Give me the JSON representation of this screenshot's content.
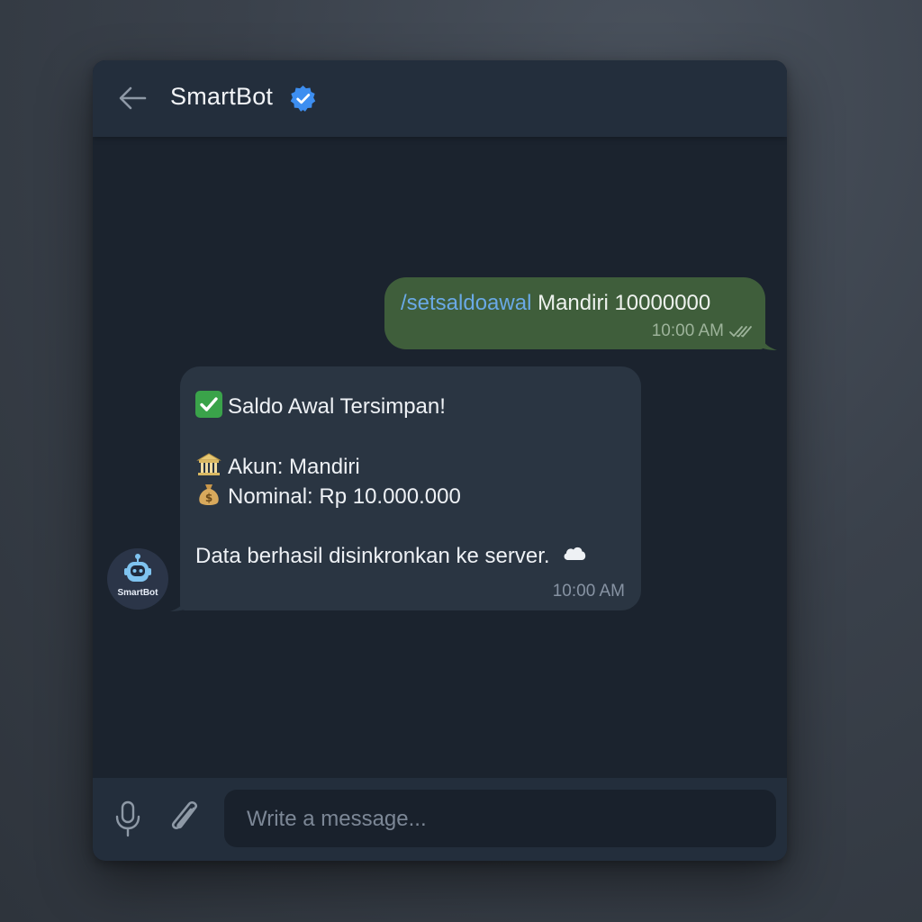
{
  "header": {
    "title": "SmartBot",
    "back_icon": "arrow-left-icon",
    "verified_icon": "verified-badge-icon"
  },
  "messages": {
    "outgoing": {
      "command": "/setsaldoawal",
      "text": " Mandiri 10000000",
      "time": "10:00 AM",
      "status_icon": "double-check-icon"
    },
    "incoming": {
      "title": "Saldo Awal Tersimpan!",
      "account_line": "Akun: Mandiri",
      "nominal_line": "Nominal: Rp 10.000.000",
      "sync_line": "Data berhasil disinkronkan ke server.",
      "time": "10:00 AM",
      "emoji_icons": [
        "check-mark-button-icon",
        "bank-icon",
        "money-bag-icon",
        "cloud-icon"
      ]
    }
  },
  "avatar": {
    "label": "SmartBot",
    "icon": "robot-icon"
  },
  "composer": {
    "placeholder": "Write a message...",
    "value": "",
    "mic_icon": "microphone-icon",
    "attach_icon": "paperclip-icon"
  },
  "colors": {
    "outgoing_bubble": "#3f5e3b",
    "incoming_bubble": "#2a3542",
    "command_link": "#6aa9e6",
    "verified_badge": "#3d8ef0",
    "window_bg": "#1b232e"
  }
}
